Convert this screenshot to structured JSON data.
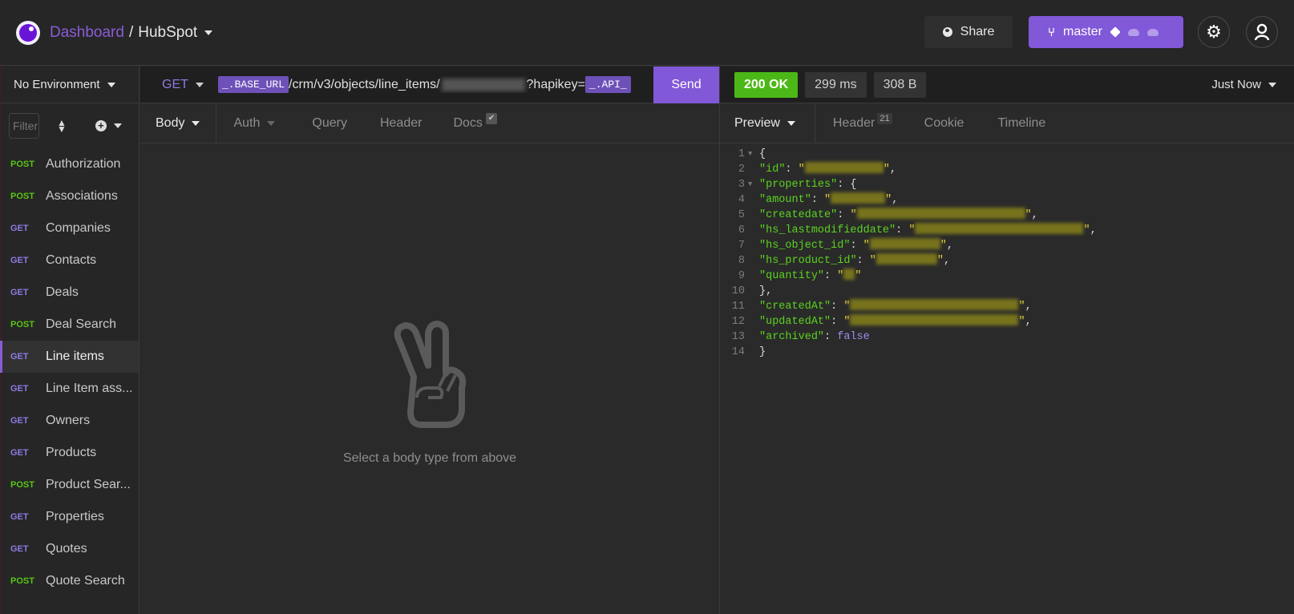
{
  "header": {
    "breadcrumb_root": "Dashboard",
    "breadcrumb_separator": "/",
    "project": "HubSpot",
    "share_label": "Share",
    "branch_label": "master",
    "icons": [
      "app-logo-icon",
      "globe-icon",
      "git-branch-icon",
      "cube-icon",
      "cloud-pull-icon",
      "cloud-push-icon",
      "gear-icon",
      "user-icon"
    ]
  },
  "sidebar": {
    "environment": "No Environment",
    "filter_placeholder": "Filter",
    "requests": [
      {
        "method": "POST",
        "name": "Authorization",
        "active": false
      },
      {
        "method": "POST",
        "name": "Associations",
        "active": false
      },
      {
        "method": "GET",
        "name": "Companies",
        "active": false
      },
      {
        "method": "GET",
        "name": "Contacts",
        "active": false
      },
      {
        "method": "GET",
        "name": "Deals",
        "active": false
      },
      {
        "method": "POST",
        "name": "Deal Search",
        "active": false
      },
      {
        "method": "GET",
        "name": "Line items",
        "active": true
      },
      {
        "method": "GET",
        "name": "Line Item ass...",
        "active": false
      },
      {
        "method": "GET",
        "name": "Owners",
        "active": false
      },
      {
        "method": "GET",
        "name": "Products",
        "active": false
      },
      {
        "method": "POST",
        "name": "Product Sear...",
        "active": false
      },
      {
        "method": "GET",
        "name": "Properties",
        "active": false
      },
      {
        "method": "GET",
        "name": "Quotes",
        "active": false
      },
      {
        "method": "POST",
        "name": "Quote Search",
        "active": false
      }
    ]
  },
  "request": {
    "method": "GET",
    "url_var1": "_.BASE_URL",
    "url_path": "/crm/v3/objects/line_items/",
    "url_query": "?hapikey=",
    "url_var2": "_.API_",
    "send_label": "Send",
    "tabs": [
      "Body",
      "Auth",
      "Query",
      "Header",
      "Docs"
    ],
    "empty_message": "Select a body type from above"
  },
  "response": {
    "status": "200 OK",
    "time": "299 ms",
    "size": "308 B",
    "history": "Just Now",
    "tabs": [
      "Preview",
      "Header",
      "Cookie",
      "Timeline"
    ],
    "header_count": "21",
    "json_lines": [
      {
        "n": "1",
        "fold": true
      },
      {
        "n": "2",
        "key": "id"
      },
      {
        "n": "3",
        "key": "properties",
        "fold": true
      },
      {
        "n": "4",
        "key": "amount"
      },
      {
        "n": "5",
        "key": "createdate"
      },
      {
        "n": "6",
        "key": "hs_lastmodifieddate"
      },
      {
        "n": "7",
        "key": "hs_object_id"
      },
      {
        "n": "8",
        "key": "hs_product_id"
      },
      {
        "n": "9",
        "key": "quantity"
      },
      {
        "n": "10"
      },
      {
        "n": "11",
        "key": "createdAt"
      },
      {
        "n": "12",
        "key": "updatedAt"
      },
      {
        "n": "13",
        "key": "archived",
        "value": "false"
      },
      {
        "n": "14"
      }
    ]
  }
}
